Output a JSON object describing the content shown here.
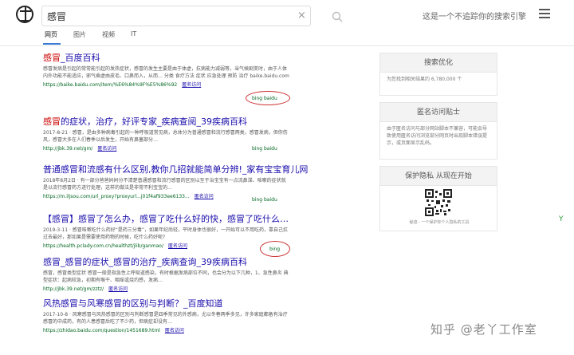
{
  "header": {
    "search_value": "感冒",
    "clear_glyph": "×",
    "tagline": "这是一个不追踪你的搜索引擎",
    "logo_icon": "compass-logo-icon",
    "search_icon": "search-icon",
    "menu_icon": "hamburger-menu-icon"
  },
  "tabs": [
    {
      "label": "网页",
      "active": true
    },
    {
      "label": "图片",
      "active": false
    },
    {
      "label": "视频",
      "active": false
    },
    {
      "label": "IT",
      "active": false
    }
  ],
  "results": [
    {
      "title_hl": "感冒",
      "title_rest": "_百度百科",
      "title_tail": "",
      "snippet": "感冒发病是引起的常常能引起的发热症状，感冒的发生主要是由于体虚，抗病能力减弱等，当气候剧变时，由于人体内外功能不能适应，邪气乘虚由皮毛、口鼻而入，从而… 分类 食疗方法 症状 应急处理 预防 治疗 baike.baidu.com",
      "url": "https://baike.baidu.com/item/%E6%84%9F%E5%86%92",
      "cache": "匿名访问",
      "engine": "bing baidu"
    },
    {
      "title_hl": "感冒",
      "title_rest": "的症状，治疗，好评专家_疾病查阅_39疾病百科",
      "title_tail": "",
      "snippet": "2017-8-21 · 感冒，是由多种病毒引起的一种呼吸道常见病，总体分为普通感冒和流行感冒两类，感冒发病，但你伤风，感冒大多在人们春季以后发生，开始有鼻塞部分…",
      "url": "http://jbk.39.net/gm/",
      "cache": "匿名访问",
      "engine": "bing baidu"
    },
    {
      "title_hl": "",
      "title_rest": "普通感冒和流感有什么区别,教你几招就能简单分辨!_家有宝宝育儿网",
      "title_tail": "",
      "snippet": "2018年8月2日 · 有一部分爸爸妈妈分不清楚普通感冒和流行感冒的区别以至于治宝宝有一点流鼻涕、咳嗽的症状就是以流行感冒药方进行处理，这样的做法是非常不利宝宝的…",
      "url": "https://m.iljsou.com/url_proxy?proxyurl...j01f4af933ee6133...",
      "cache": "匿名访问",
      "engine": "bing baidu"
    },
    {
      "title_hl": "",
      "title_rest": "【感冒】感冒了怎么办，感冒了吃什么好的快，感冒了吃什么…",
      "title_tail": "",
      "snippet": "2019-3-11 · 感冒咳嗽吃什么药好“是药三分毒”，如果年纪尚轻，平时身体也很好，一开始可以不用吃药，靠自己扛过去最好，那如果是需要使用药物的时候，吃什么药好呢?",
      "url": "https://health.pclady.com.cn/healthzt/jlib/ganmao/",
      "cache": "匿名访问",
      "engine": "bing"
    },
    {
      "title_hl": "",
      "title_rest": "感冒_感冒的症状_感冒的治疗_疾病查询_39疾病百科",
      "title_tail": "",
      "snippet": "感冒，感冒类型症状 感冒一般是指急性上呼吸道感染，有时根据发病部位不同，也会分为以下几种，1、急性鼻炎 典型症状：起病较急，初期有喉干、咽痒或烧灼感，发病…",
      "url": "http://jbk.39.net/gm/zztz/",
      "cache": "匿名访问",
      "engine": ""
    },
    {
      "title_hl": "",
      "title_rest": "风热感冒与风寒感冒的区别与判断？_百度知道",
      "title_tail": "",
      "snippet": "2017-10-8 · 风寒感冒与风热感冒的区别与判断感冒是四季常见的外感病，尤以冬春两季多见，许多家庭都备有治疗感冒的中成药，有的人患感冒后吃了不少药，但病症却没有…",
      "url": "https://zhidao.baidu.com/question/1451689.html",
      "cache": "匿名访问",
      "engine": ""
    }
  ],
  "sidebar": {
    "seo_title": "搜索优化",
    "seo_body": "为您找到相关结果约 6,780,000 个",
    "anon_title": "匿名访问贴士",
    "anon_body": "由于匿名访问与部分网站脚本不兼容，可能会导致使用匿名访问浏览部分网页时出现脚本错误提示，或页面显示乱码。",
    "privacy_title": "保护隐私 从现在开始",
    "privacy_caption": "秘迹 - 一个保护你个人隐私的工具",
    "qr_icon": "qr-code-icon"
  },
  "watermark": "知乎 @老丫工作室",
  "green_mark": "Y",
  "colors": {
    "accent": "#3a7bd5",
    "title": "#1a0dab",
    "highlight": "#cc0000",
    "url": "#006621",
    "annotation": "#cc3333"
  }
}
